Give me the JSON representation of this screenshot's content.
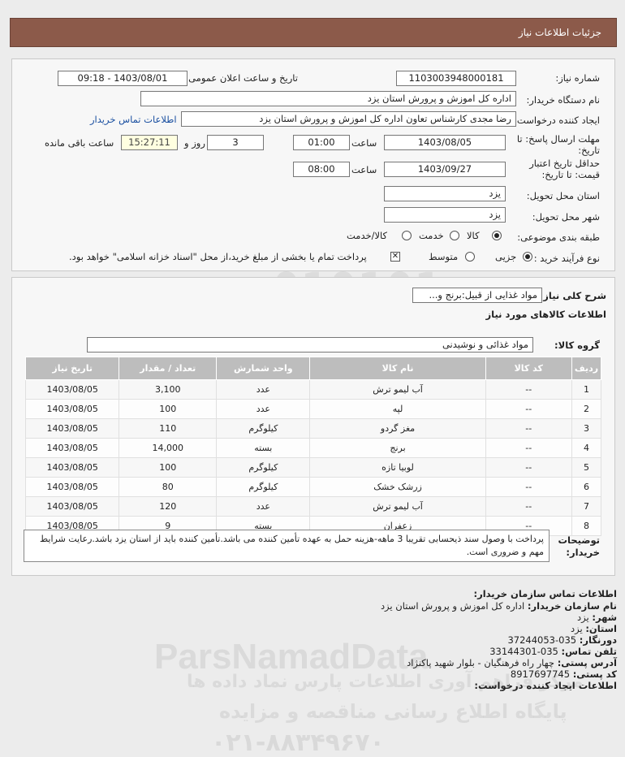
{
  "header": {
    "title": "جزئیات اطلاعات نیاز"
  },
  "form": {
    "need_number_label": "شماره نیاز:",
    "need_number": "1103003948000181",
    "announce_label": "تاریخ و ساعت اعلان عمومی:",
    "announce_value": "1403/08/01 - 09:18",
    "buyer_org_label": "نام دستگاه خریدار:",
    "buyer_org": "اداره کل اموزش و پرورش استان یزد",
    "creator_label": "ایجاد کننده درخواست:",
    "creator": "رضا مجدی کارشناس تعاون اداره کل اموزش و پرورش استان یزد",
    "contact_link": "اطلاعات تماس خریدار",
    "deadline_label_1": "مهلت ارسال پاسخ: تا",
    "deadline_label_2": "تاریخ:",
    "deadline_date": "1403/08/05",
    "time_label": "ساعت",
    "deadline_time": "01:00",
    "days": "3",
    "days_label": "روز و",
    "remaining_time": "15:27:11",
    "remaining_label": "ساعت باقی مانده",
    "validity_label_1": "حداقل تاریخ اعتبار",
    "validity_label_2": "قیمت: تا تاریخ:",
    "validity_date": "1403/09/27",
    "validity_time": "08:00",
    "delivery_place_label": "استان محل تحویل:",
    "delivery_place": "یزد",
    "delivery_city_label": "شهر محل تحویل:",
    "delivery_city": "یزد",
    "category_label": "طبقه بندی موضوعی:",
    "category_options": [
      "کالا",
      "خدمت",
      "کالا/خدمت"
    ],
    "process_label": "نوع فرآیند خرید :",
    "process_options": [
      "جزیی",
      "متوسط"
    ],
    "payment_note": "پرداخت تمام یا بخشی از مبلغ خرید،از محل \"اسناد خزانه اسلامی\" خواهد بود."
  },
  "needs": {
    "summary_label": "شرح کلی نیاز:",
    "summary": "مواد غذایی از قبیل:برنج و...",
    "goods_info_title": "اطلاعات کالاهای مورد نیاز",
    "group_label": "گروه کالا:",
    "group": "مواد غذائی و نوشیدنی",
    "columns": [
      "ردیف",
      "کد کالا",
      "نام کالا",
      "واحد شمارش",
      "تعداد / مقدار",
      "تاریخ نیاز"
    ],
    "rows": [
      [
        "1",
        "--",
        "آب لیمو ترش",
        "عدد",
        "3,100",
        "1403/08/05"
      ],
      [
        "2",
        "--",
        "لپه",
        "عدد",
        "100",
        "1403/08/05"
      ],
      [
        "3",
        "--",
        "مغز گردو",
        "کیلوگرم",
        "110",
        "1403/08/05"
      ],
      [
        "4",
        "--",
        "برنج",
        "بسته",
        "14,000",
        "1403/08/05"
      ],
      [
        "5",
        "--",
        "لوبیا تازه",
        "کیلوگرم",
        "100",
        "1403/08/05"
      ],
      [
        "6",
        "--",
        "زرشک خشک",
        "کیلوگرم",
        "80",
        "1403/08/05"
      ],
      [
        "7",
        "--",
        "آب لیمو ترش",
        "عدد",
        "120",
        "1403/08/05"
      ],
      [
        "8",
        "--",
        "زعفران",
        "بسته",
        "9",
        "1403/08/05"
      ]
    ],
    "buyer_notes_label_1": "توضیحات",
    "buyer_notes_label_2": "خریدار:",
    "buyer_notes": "پرداخت با وصول سند ذیحسابی تقریبا 3 ماهه-هزینه حمل به عهده تأمین کننده می باشد.تأمین کننده باید از استان یزد باشد.رعایت شرایط مهم و ضروری است."
  },
  "watermark": {
    "logo_text": "ParsNamadData",
    "line1": "مرکز فراهم آوری اطلاعات پارس نماد داده ها",
    "line2": "پایگاه اطلاع رسانی مناقصه و مزایده",
    "phone": "۰۲۱-۸۸۳۴۹۶۷۰"
  },
  "contact": {
    "title": "اطلاعات تماس سازمان خریدار:",
    "org_label": "نام سازمان خریدار:",
    "org": "اداره کل اموزش و پرورش استان یزد",
    "city_label": "شهر:",
    "city": "یزد",
    "province_label": "استان:",
    "province": "یزد",
    "fax_label": "دورنگار:",
    "fax": "035-37244053",
    "phone_label": "تلفن تماس:",
    "phone": "035-33144301",
    "address_label": "آدرس پستی:",
    "address": "چهار راه فرهنگیان - بلوار شهید پاکنژاد",
    "postal_label": "کد پستی:",
    "postal": "8917697745",
    "creator_info": "اطلاعات ایجاد کننده درخواست:"
  }
}
